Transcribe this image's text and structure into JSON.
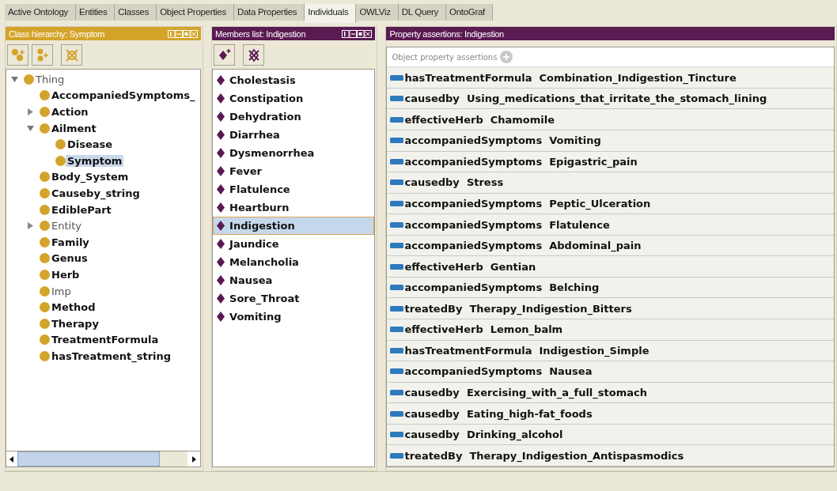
{
  "tabs": [
    {
      "label": "Active Ontology",
      "selected": false
    },
    {
      "label": "Entities",
      "selected": false
    },
    {
      "label": "Classes",
      "selected": false
    },
    {
      "label": "Object Properties",
      "selected": false
    },
    {
      "label": "Data Properties",
      "selected": false
    },
    {
      "label": "Individuals",
      "selected": true
    },
    {
      "label": "OWLViz",
      "selected": false
    },
    {
      "label": "DL Query",
      "selected": false
    },
    {
      "label": "OntoGraf",
      "selected": false
    }
  ],
  "class_hierarchy": {
    "title": "Class hierarchy: Symptom",
    "tree": [
      {
        "label": "Thing",
        "bold": false,
        "expanded": true,
        "selected": false,
        "children": [
          {
            "label": "AccompaniedSymptoms_",
            "bold": true,
            "selected": false
          },
          {
            "label": "Action",
            "bold": true,
            "expanded": false,
            "selected": false
          },
          {
            "label": "Ailment",
            "bold": true,
            "expanded": true,
            "selected": false,
            "children": [
              {
                "label": "Disease",
                "bold": true,
                "selected": false
              },
              {
                "label": "Symptom",
                "bold": true,
                "selected": true
              }
            ]
          },
          {
            "label": "Body_System",
            "bold": true,
            "selected": false
          },
          {
            "label": "Causeby_string",
            "bold": true,
            "selected": false
          },
          {
            "label": "EdiblePart",
            "bold": true,
            "selected": false
          },
          {
            "label": "Entity",
            "bold": false,
            "expanded": false,
            "selected": false
          },
          {
            "label": "Family",
            "bold": true,
            "selected": false
          },
          {
            "label": "Genus",
            "bold": true,
            "selected": false
          },
          {
            "label": "Herb",
            "bold": true,
            "selected": false
          },
          {
            "label": "Imp",
            "bold": false,
            "selected": false
          },
          {
            "label": "Method",
            "bold": true,
            "selected": false
          },
          {
            "label": "Therapy",
            "bold": true,
            "selected": false
          },
          {
            "label": "TreatmentFormula",
            "bold": true,
            "selected": false
          },
          {
            "label": "hasTreatment_string",
            "bold": true,
            "selected": false
          }
        ]
      }
    ]
  },
  "members_list": {
    "title": "Members list: Indigestion",
    "items": [
      {
        "label": "Cholestasis",
        "selected": false
      },
      {
        "label": "Constipation",
        "selected": false
      },
      {
        "label": "Dehydration",
        "selected": false
      },
      {
        "label": "Diarrhea",
        "selected": false
      },
      {
        "label": "Dysmenorrhea",
        "selected": false
      },
      {
        "label": "Fever",
        "selected": false
      },
      {
        "label": "Flatulence",
        "selected": false
      },
      {
        "label": "Heartburn",
        "selected": false
      },
      {
        "label": "Indigestion",
        "selected": true
      },
      {
        "label": "Jaundice",
        "selected": false
      },
      {
        "label": "Melancholia",
        "selected": false
      },
      {
        "label": "Nausea",
        "selected": false
      },
      {
        "label": "Sore_Throat",
        "selected": false
      },
      {
        "label": "Vomiting",
        "selected": false
      }
    ]
  },
  "property_assertions": {
    "title": "Property assertions: Indigestion",
    "section": "Object property assertions",
    "rows": [
      {
        "property": "hasTreatmentFormula",
        "value": "Combination_Indigestion_Tincture"
      },
      {
        "property": "causedby",
        "value": "Using_medications_that_irritate_the_stomach_lining"
      },
      {
        "property": "effectiveHerb",
        "value": "Chamomile"
      },
      {
        "property": "accompaniedSymptoms",
        "value": "Vomiting"
      },
      {
        "property": "accompaniedSymptoms",
        "value": "Epigastric_pain"
      },
      {
        "property": "causedby",
        "value": "Stress"
      },
      {
        "property": "accompaniedSymptoms",
        "value": "Peptic_Ulceration"
      },
      {
        "property": "accompaniedSymptoms",
        "value": "Flatulence"
      },
      {
        "property": "accompaniedSymptoms",
        "value": "Abdominal_pain"
      },
      {
        "property": "effectiveHerb",
        "value": "Gentian"
      },
      {
        "property": "accompaniedSymptoms",
        "value": "Belching"
      },
      {
        "property": "treatedBy",
        "value": "Therapy_Indigestion_Bitters"
      },
      {
        "property": "effectiveHerb",
        "value": "Lemon_balm"
      },
      {
        "property": "hasTreatmentFormula",
        "value": "Indigestion_Simple"
      },
      {
        "property": "accompaniedSymptoms",
        "value": "Nausea"
      },
      {
        "property": "causedby",
        "value": "Exercising_with_a_full_stomach"
      },
      {
        "property": "causedby",
        "value": "Eating_high-fat_foods"
      },
      {
        "property": "causedby",
        "value": "Drinking_alcohol"
      },
      {
        "property": "treatedBy",
        "value": "Therapy_Indigestion_Antispasmodics"
      }
    ]
  }
}
